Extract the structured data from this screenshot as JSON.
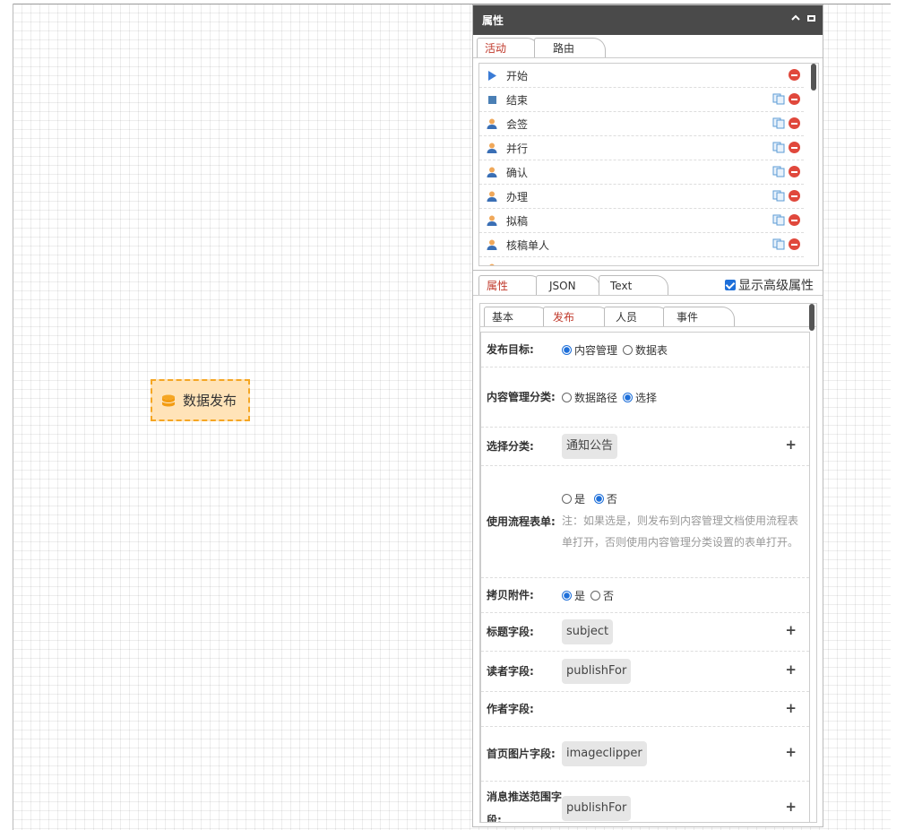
{
  "canvas": {
    "node_label": "数据发布"
  },
  "panel": {
    "title": "属性",
    "tabs": [
      {
        "label": "活动",
        "active": true
      },
      {
        "label": "路由",
        "active": false
      }
    ],
    "activities": [
      {
        "label": "开始",
        "icon": "triangle-start-icon"
      },
      {
        "label": "结束",
        "icon": "square-end-icon"
      },
      {
        "label": "会签",
        "icon": "person-icon"
      },
      {
        "label": "并行",
        "icon": "person-icon"
      },
      {
        "label": "确认",
        "icon": "person-icon"
      },
      {
        "label": "办理",
        "icon": "person-icon"
      },
      {
        "label": "拟稿",
        "icon": "person-icon"
      },
      {
        "label": "核稿单人",
        "icon": "person-icon"
      }
    ],
    "props_tabs": [
      {
        "label": "属性",
        "active": true
      },
      {
        "label": "JSON",
        "active": false
      },
      {
        "label": "Text",
        "active": false
      }
    ],
    "show_advanced_label": "显示高级属性",
    "sub_tabs": [
      {
        "label": "基本",
        "active": false
      },
      {
        "label": "发布",
        "active": true
      },
      {
        "label": "人员",
        "active": false
      },
      {
        "label": "事件",
        "active": false
      }
    ],
    "form": {
      "target_label": "发布目标:",
      "target_opt1": "内容管理",
      "target_opt2": "数据表",
      "category_label": "内容管理分类:",
      "category_opt1": "数据路径",
      "category_opt2": "选择",
      "select_category_label": "选择分类:",
      "select_category_value": "通知公告",
      "use_form_label": "使用流程表单:",
      "use_form_yes": "是",
      "use_form_no": "否",
      "use_form_note": "注：如果选是，则发布到内容管理文档使用流程表单打开，否则使用内容管理分类设置的表单打开。",
      "copy_attach_label": "拷贝附件:",
      "copy_attach_yes": "是",
      "copy_attach_no": "否",
      "title_field_label": "标题字段:",
      "title_field_value": "subject",
      "reader_field_label": "读者字段:",
      "reader_field_value": "publishFor",
      "author_field_label": "作者字段:",
      "image_field_label": "首页图片字段:",
      "image_field_value": "imageclipper",
      "push_field_label": "消息推送范围字段:",
      "push_field_value": "publishFor"
    }
  }
}
